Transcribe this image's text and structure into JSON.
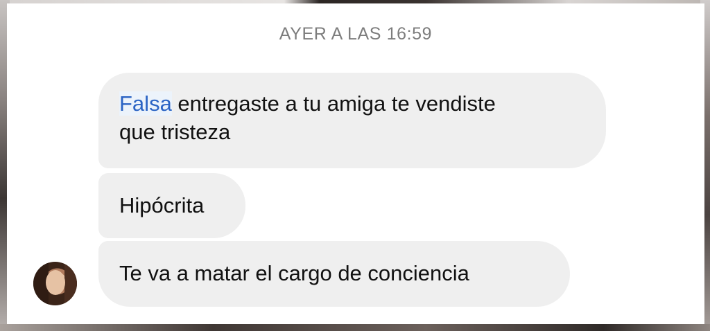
{
  "thread": {
    "timestamp": "AYER A LAS 16:59"
  },
  "messages": [
    {
      "highlight": "Falsa",
      "line1_rest": " entregaste a tu amiga te vendiste",
      "line2": "que tristeza"
    },
    {
      "text": "Hipócrita"
    },
    {
      "text": "Te va a matar el cargo de conciencia"
    }
  ],
  "sender": {
    "avatar_icon": "profile-photo"
  },
  "colors": {
    "bubble": "#efefef",
    "timestamp": "#7d7d7d",
    "highlight_text": "#2b64c4",
    "highlight_bg": "#ecf3fb"
  }
}
